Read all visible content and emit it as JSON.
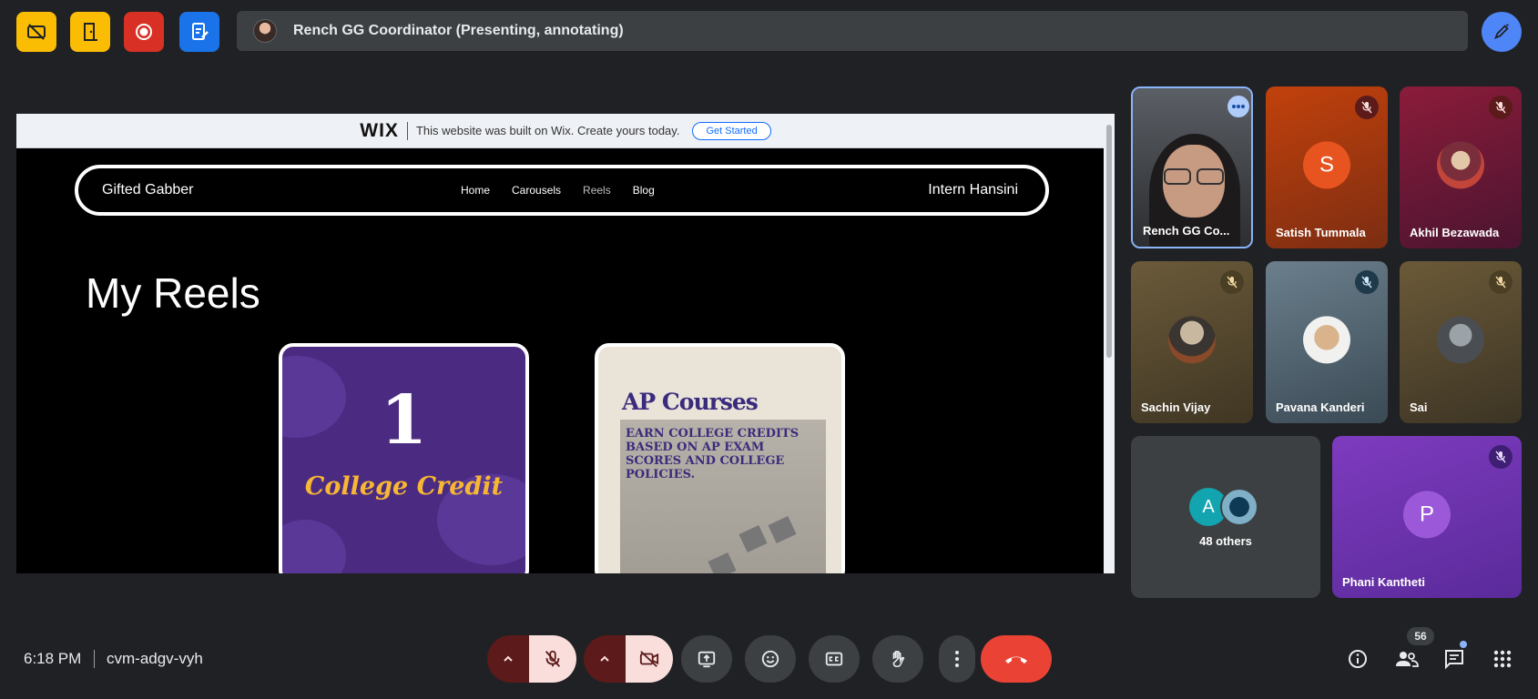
{
  "colors": {
    "background": "#202124",
    "accent_yellow": "#fbbc04",
    "record_red": "#d93025",
    "blue": "#1a73e8",
    "end_call": "#ea4335",
    "muted_bg": "#5c1a1a",
    "muted_fg": "#f9dedc"
  },
  "topbar": {
    "buttons": [
      {
        "icon": "no-captions-icon"
      },
      {
        "icon": "door-icon"
      },
      {
        "icon": "record-icon"
      },
      {
        "icon": "form-edit-icon"
      }
    ],
    "presenting_text": "Rench GG Coordinator (Presenting, annotating)",
    "pen_icon": "annotate-pen-icon"
  },
  "presentation": {
    "wix_logo": "WIX",
    "wix_text": "This website was built on Wix. Create yours today.",
    "wix_button": "Get Started",
    "site_name": "Gifted Gabber",
    "nav": [
      "Home",
      "Carousels",
      "Reels",
      "Blog"
    ],
    "site_user": "Intern Hansini",
    "heading": "My Reels",
    "reel1": {
      "number": "1",
      "caption": "College Credit"
    },
    "reel2": {
      "title": "AP Courses",
      "text": "EARN COLLEGE CREDITS BASED ON AP EXAM SCORES AND COLLEGE POLICIES."
    }
  },
  "participants": [
    {
      "name": "Rench GG Co...",
      "type": "video"
    },
    {
      "name": "Satish Tummala",
      "letter": "S",
      "muted": true
    },
    {
      "name": "Akhil Bezawada",
      "muted": true
    },
    {
      "name": "Sachin Vijay",
      "muted": true
    },
    {
      "name": "Pavana Kanderi",
      "muted": true
    },
    {
      "name": "Sai",
      "muted": true
    },
    {
      "others_label": "48 others",
      "letter": "A"
    },
    {
      "name": "Phani Kantheti",
      "letter": "P",
      "muted": true
    }
  ],
  "bottombar": {
    "time": "6:18 PM",
    "meeting_code": "cvm-adgv-vyh",
    "people_count": "56"
  }
}
